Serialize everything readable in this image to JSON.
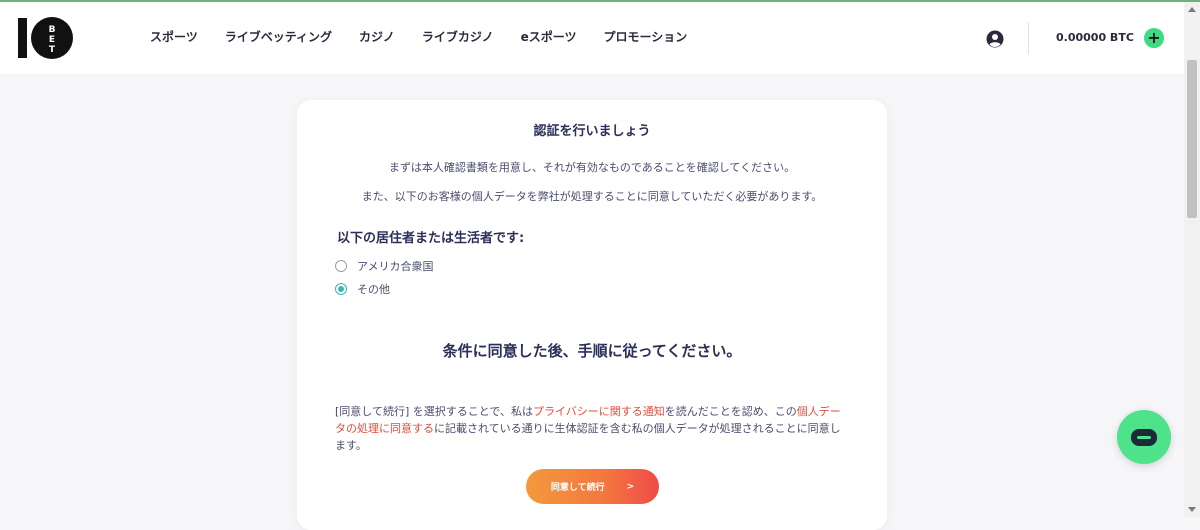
{
  "header": {
    "logo_text": "10BET",
    "nav": [
      "スポーツ",
      "ライブベッティング",
      "カジノ",
      "ライブカジノ",
      "eスポーツ",
      "プロモーション"
    ],
    "balance": "0.00000 BTC",
    "plus_label": "+",
    "user_icon": "user-circle-icon"
  },
  "card": {
    "title": "認証を行いましょう",
    "para1": "まずは本人確認書類を用意し、それが有効なものであることを確認してください。",
    "para2": "また、以下のお客様の個人データを弊社が処理することに同意していただく必要があります。",
    "residency_label": "以下の居住者または生活者です:",
    "options": [
      {
        "label": "アメリカ合衆国",
        "selected": false
      },
      {
        "label": "その他",
        "selected": true
      }
    ],
    "subtitle": "条件に同意した後、手順に従ってください。",
    "consent": {
      "part1": "[同意して続行] を選択することで、私は",
      "link1": "プライバシーに関する通知",
      "part2": "を読んだことを認め、この",
      "link2": "個人データの処理に同意する",
      "part3": "に記載されている通りに生体認証を含む私の個人データが処理されることに同意します。"
    },
    "cta_label": "同意して続行",
    "cta_arrow": ">"
  },
  "colors": {
    "accent_green": "#3ddc84",
    "link_red": "#e64b3b",
    "radio_teal": "#3bb7b1",
    "cta_gradient": [
      "#f39a3c",
      "#ee4b47"
    ]
  },
  "chat_icon": "chat-bubble-icon"
}
